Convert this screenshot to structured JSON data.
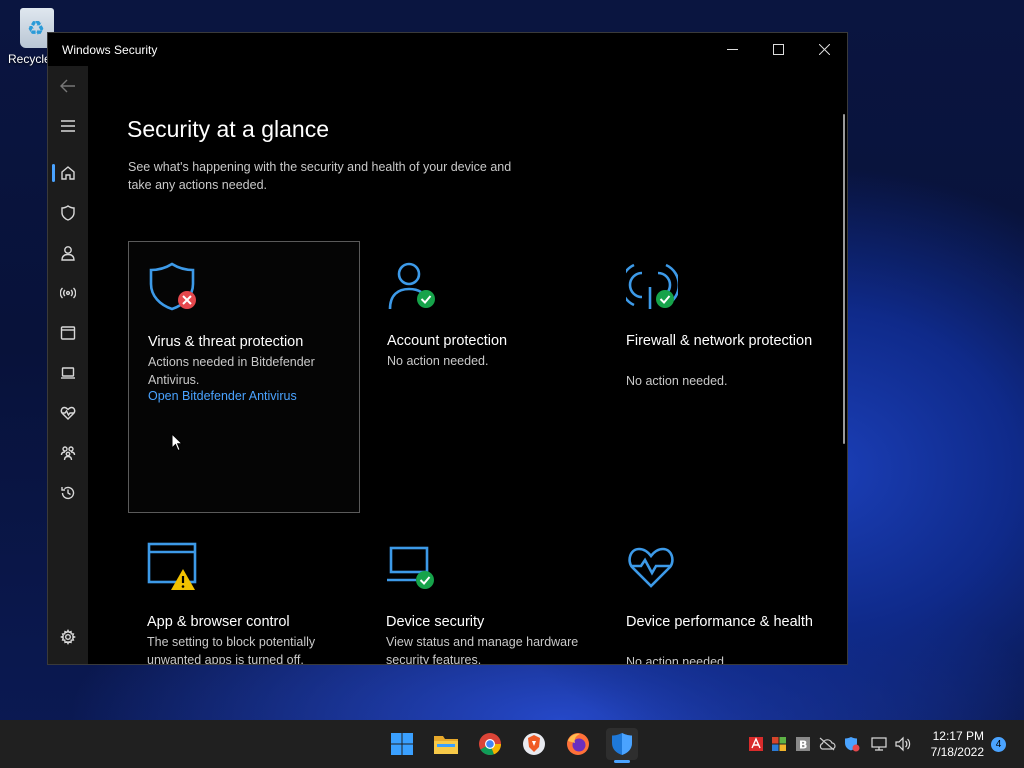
{
  "desktop": {
    "recycle_label": "Recycle"
  },
  "window": {
    "title": "Windows Security",
    "heading": "Security at a glance",
    "subtitle": "See what's happening with the security and health of your device and take any actions needed."
  },
  "sidebar": {
    "items": [
      "back-arrow-icon",
      "hamburger-menu-icon",
      "home-icon",
      "shield-icon",
      "person-icon",
      "wifi-antenna-icon",
      "browser-window-icon",
      "laptop-icon",
      "heart-pulse-icon",
      "family-icon",
      "history-icon",
      "gear-icon"
    ],
    "accent": "#4aa3ff"
  },
  "cards": [
    {
      "title": "Virus & threat protection",
      "desc": "Actions needed in Bitdefender Antivirus.",
      "link": "Open Bitdefender Antivirus",
      "status": "error"
    },
    {
      "title": "Account protection",
      "desc": "No action needed.",
      "status": "ok"
    },
    {
      "title": "Firewall & network protection",
      "desc": "No action needed.",
      "status": "ok"
    },
    {
      "title": "App & browser control",
      "desc": "The setting to block potentially unwanted apps is turned off.",
      "status": "warning"
    },
    {
      "title": "Device security",
      "desc": "View status and manage hardware security features.",
      "status": "ok"
    },
    {
      "title": "Device performance & health",
      "desc": "No action needed.",
      "status": "none"
    }
  ],
  "colors": {
    "icon_blue": "#3d9ae8",
    "ok": "#16a34a",
    "error": "#e5484d",
    "warning": "#f2c200"
  },
  "taskbar": {
    "apps": [
      "windows-start-icon",
      "file-explorer-icon",
      "chrome-icon",
      "brave-icon",
      "firefox-icon",
      "windows-security-icon"
    ],
    "time": "12:17 PM",
    "date": "7/18/2022",
    "notifications": "4"
  }
}
